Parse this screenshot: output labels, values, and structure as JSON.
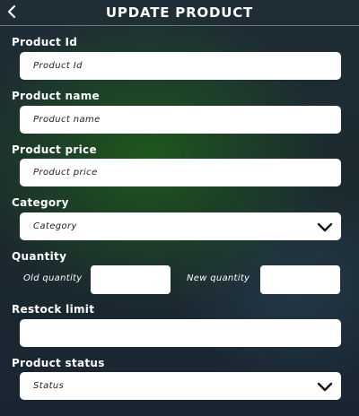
{
  "header": {
    "title": "UPDATE PRODUCT",
    "back_icon": "chevron-left-icon"
  },
  "form": {
    "product_id": {
      "label": "Product Id",
      "placeholder": "Product Id"
    },
    "product_name": {
      "label": "Product name",
      "placeholder": "Product name"
    },
    "product_price": {
      "label": "Product price",
      "placeholder": "Product price"
    },
    "category": {
      "label": "Category",
      "selected": "Category",
      "icon": "chevron-down-icon"
    },
    "quantity": {
      "label": "Quantity",
      "old_label": "Old quantity",
      "new_label": "New quantity",
      "old_value": "",
      "new_value": ""
    },
    "restock_limit": {
      "label": "Restock limit",
      "value": ""
    },
    "product_status": {
      "label": "Product status",
      "selected": "Status",
      "icon": "chevron-down-icon"
    }
  }
}
